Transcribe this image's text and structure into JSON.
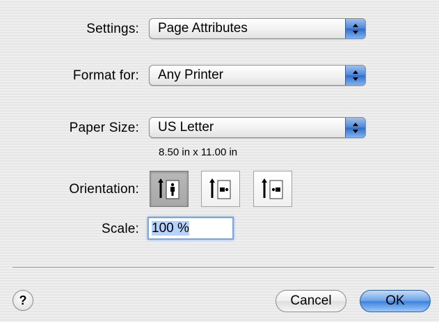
{
  "settings": {
    "label": "Settings:",
    "value": "Page Attributes"
  },
  "format_for": {
    "label": "Format for:",
    "value": "Any Printer"
  },
  "paper_size": {
    "label": "Paper Size:",
    "value": "US Letter",
    "dimensions": "8.50 in x 11.00 in"
  },
  "orientation": {
    "label": "Orientation:",
    "options": [
      "portrait",
      "landscape",
      "landscape-reversed"
    ],
    "selected": "portrait"
  },
  "scale": {
    "label": "Scale:",
    "value": "100 %"
  },
  "buttons": {
    "help": "?",
    "cancel": "Cancel",
    "ok": "OK"
  },
  "colors": {
    "accent": "#3e82de",
    "selection": "#b5d3ff"
  }
}
